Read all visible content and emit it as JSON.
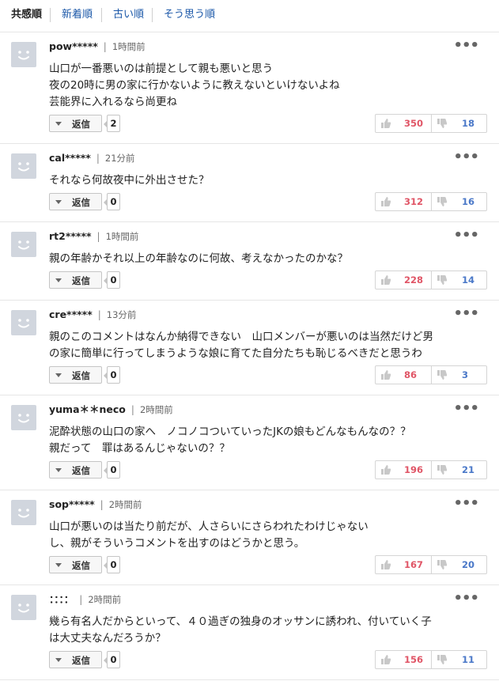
{
  "sort_tabs": [
    "共感順",
    "新着順",
    "古い順",
    "そう思う順"
  ],
  "reply_label": "返信",
  "more_label": "•••",
  "comments": [
    {
      "user": "pow*****",
      "time": "1時間前",
      "lines": [
        "山口が一番悪いのは前提として親も悪いと思う",
        "夜の20時に男の家に行かないように教えないといけないよね",
        "芸能界に入れるなら尚更ね"
      ],
      "replies": "2",
      "likes": "350",
      "dislikes": "18"
    },
    {
      "user": "cal*****",
      "time": "21分前",
      "lines": [
        "それなら何故夜中に外出させた？"
      ],
      "replies": "0",
      "likes": "312",
      "dislikes": "16"
    },
    {
      "user": "rt2*****",
      "time": "1時間前",
      "lines": [
        "親の年齢かそれ以上の年齢なのに何故、考えなかったのかな？"
      ],
      "replies": "0",
      "likes": "228",
      "dislikes": "14"
    },
    {
      "user": "cre*****",
      "time": "13分前",
      "lines": [
        "親のこのコメントはなんか納得できない　山口メンバーが悪いのは当然だけど男",
        "の家に簡単に行ってしまうような娘に育てた自分たちも恥じるべきだと思うわ"
      ],
      "replies": "0",
      "likes": "86",
      "dislikes": "3"
    },
    {
      "user": "yuma＊＊neco",
      "time": "2時間前",
      "lines": [
        "泥酔状態の山口の家へ　ノコノコついていったJKの娘もどんなもんなの？？",
        "親だって　罪はあるんじゃないの？？"
      ],
      "replies": "0",
      "likes": "196",
      "dislikes": "21"
    },
    {
      "user": "sop*****",
      "time": "2時間前",
      "lines": [
        "山口が悪いのは当たり前だが、人さらいにさらわれたわけじゃない",
        "し、親がそういうコメントを出すのはどうかと思う。"
      ],
      "replies": "0",
      "likes": "167",
      "dislikes": "20"
    },
    {
      "user": "：：：：",
      "time": "2時間前",
      "lines": [
        "幾ら有名人だからといって、４０過ぎの独身のオッサンに誘われ、付いていく子",
        "は大丈夫なんだろうか？"
      ],
      "replies": "0",
      "likes": "156",
      "dislikes": "11"
    }
  ]
}
